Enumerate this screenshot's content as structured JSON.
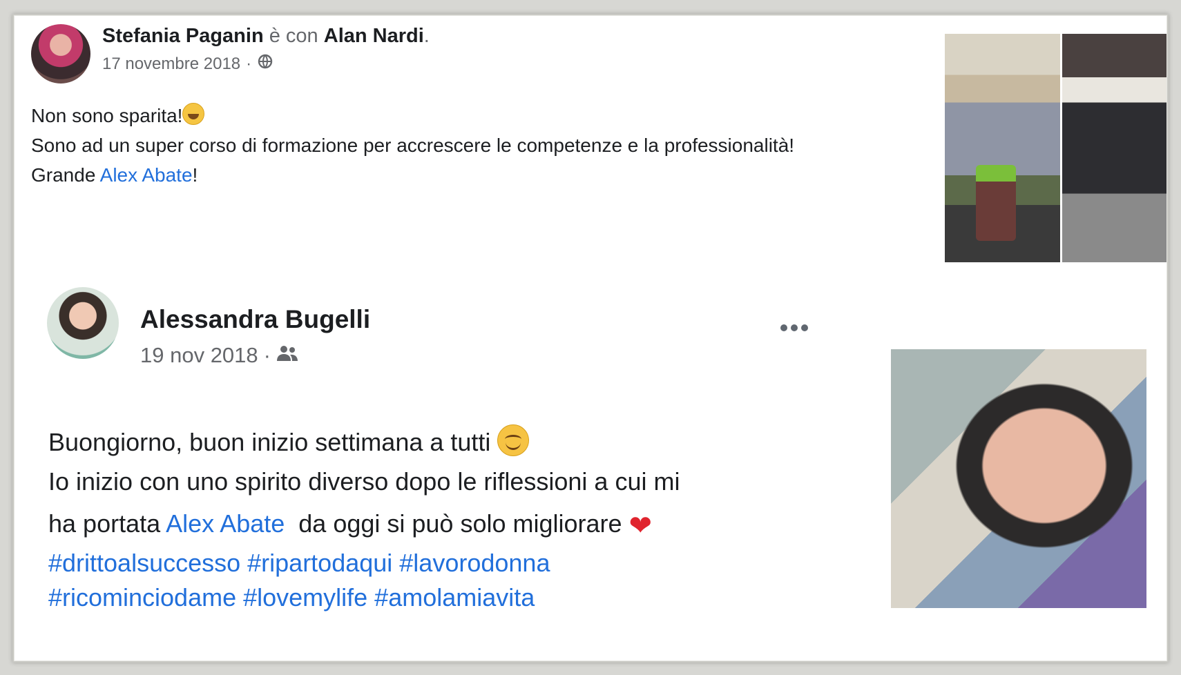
{
  "post1": {
    "author": "Stefania Paganin",
    "with_word": "è con",
    "tagged": "Alan Nardi",
    "period": ".",
    "date": "17 novembre 2018",
    "separator": "·",
    "audience_icon": "globe-icon",
    "line1": "Non sono sparita!",
    "line2": "Sono ad un super corso di formazione per accrescere le competenze e la professionalità!",
    "line3_prefix": "Grande ",
    "line3_link": "Alex Abate",
    "line3_suffix": "!"
  },
  "post2": {
    "author": "Alessandra Bugelli",
    "date": "19 nov 2018",
    "separator": "·",
    "audience_icon": "friends-icon",
    "line1": "Buongiorno, buon inizio settimana a tutti ",
    "line2": "Io inizio con uno spirito diverso dopo le riflessioni a cui mi",
    "line3_prefix": "ha portata ",
    "line3_link": "Alex Abate",
    "line3_suffix": "  da oggi si può solo migliorare ",
    "hashtags_line1": "#drittoalsuccesso #ripartodaqui #lavorodonna",
    "hashtags_line2": "#ricominciodame #lovemylife #amolamiavita"
  },
  "colors": {
    "link": "#385898",
    "hashtag": "#216fdb",
    "muted": "#65676b"
  }
}
